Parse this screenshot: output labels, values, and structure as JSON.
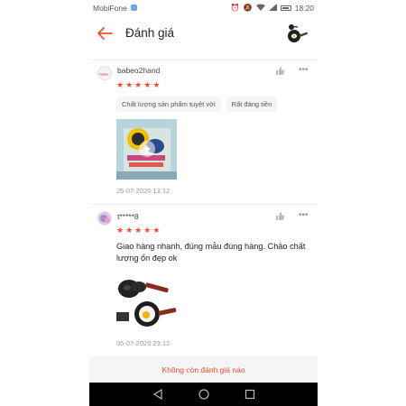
{
  "status_bar": {
    "carrier": "MobiFone",
    "time": "18:20"
  },
  "header": {
    "title": "Đánh giá",
    "logo_icon": "frying-pan-logo-icon"
  },
  "reviews": [
    {
      "username": "babeo2hand",
      "rating": 5,
      "tags": [
        "Chất lượng sản phẩm tuyệt vời",
        "Rất đáng tiền"
      ],
      "media": "video-thumbnail",
      "date": "26-07-2020 13:12"
    },
    {
      "username": "t*****8",
      "rating": 5,
      "comment": "Giao hàng nhanh, đúng mẫu đúng hàng. Chảo chất lượng ổn đẹp ok",
      "media": "product-photo",
      "date": "05-07-2020 23:12"
    }
  ],
  "footer": {
    "no_more_label": "Không còn đánh giá nào"
  },
  "colors": {
    "accent": "#ee4d2d",
    "nav_background": "#000000"
  }
}
